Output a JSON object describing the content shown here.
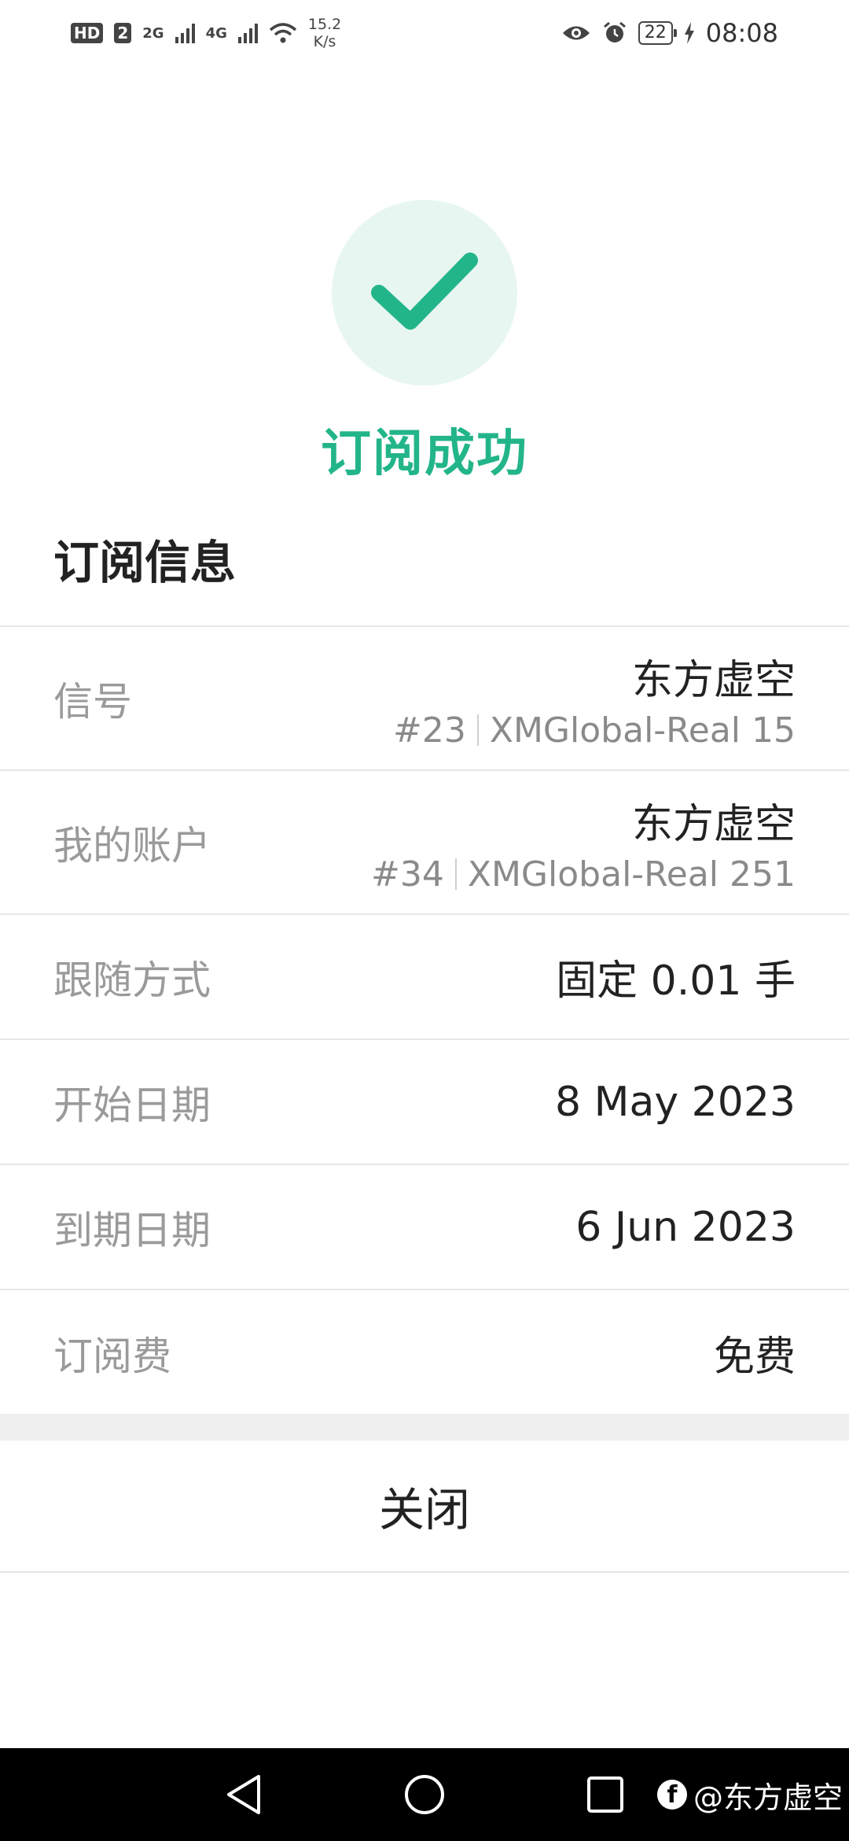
{
  "status_bar": {
    "hd_badge": "HD",
    "sim_badge": "2",
    "net1": "2G",
    "net2": "4G",
    "speed_value": "15.2",
    "speed_unit": "K/s",
    "battery": "22",
    "time": "08:08"
  },
  "success": {
    "title": "订阅成功",
    "icon": "checkmark-icon",
    "accent_color": "#23b58a"
  },
  "section_title": "订阅信息",
  "rows": {
    "signal": {
      "label": "信号",
      "value": "东方虚空",
      "id": "#23",
      "server": "XMGlobal-Real 15"
    },
    "account": {
      "label": "我的账户",
      "value": "东方虚空",
      "id": "#34",
      "server": "XMGlobal-Real 251"
    },
    "follow_mode": {
      "label": "跟随方式",
      "value": "固定 0.01 手"
    },
    "start_date": {
      "label": "开始日期",
      "value": "8 May 2023"
    },
    "end_date": {
      "label": "到期日期",
      "value": "6 Jun 2023"
    },
    "fee": {
      "label": "订阅费",
      "value": "免费"
    }
  },
  "close_label": "关闭",
  "watermark": {
    "icon": "facebook-icon",
    "text": "@东方虚空"
  }
}
